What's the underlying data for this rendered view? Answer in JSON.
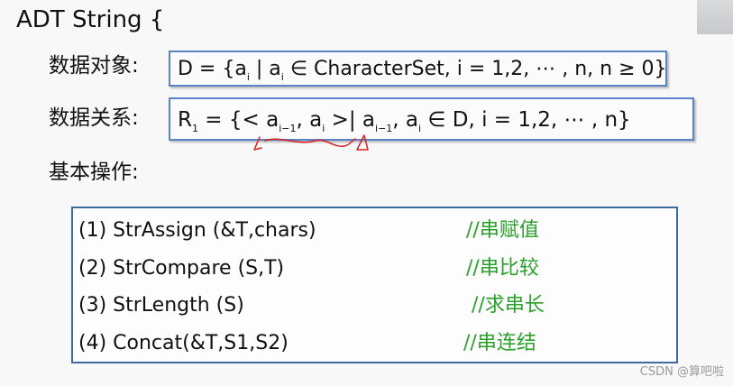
{
  "title": "ADT String {",
  "data_object": {
    "label": "数据对象:",
    "formula": {
      "part1": "D = {a",
      "sub1": "i",
      "part2": " | a",
      "sub2": "i",
      "part3": " ∈ CharacterSet, i = 1,2, ⋯ , n,  n ≥ 0}"
    }
  },
  "data_relation": {
    "label": "数据关系:",
    "formula": {
      "part1": "R",
      "sub1": "1",
      "part2": " = {< a",
      "sub2": "i−1",
      "part3": ", a",
      "sub3": "i",
      "part4": "  >| a",
      "sub4": "i−1",
      "part5": ", a",
      "sub5": "i",
      "part6": " ∈ D, i = 1,2, ⋯ , n}"
    }
  },
  "basic_operations": {
    "label": "基本操作:",
    "items": [
      {
        "signature": "(1)  StrAssign (&T,chars)",
        "comment": "//串赋值"
      },
      {
        "signature": "(2) StrCompare (S,T)",
        "comment": "//串比较"
      },
      {
        "signature": "(3) StrLength (S)",
        "comment": "//求串长"
      },
      {
        "signature": "(4) Concat(&T,S1,S2)",
        "comment": "//串连结"
      }
    ]
  },
  "colors": {
    "box_border": "#5b84c6",
    "comment_green": "#2ca02c",
    "annotation_red": "#d62020"
  },
  "watermark": "CSDN @算吧啦"
}
